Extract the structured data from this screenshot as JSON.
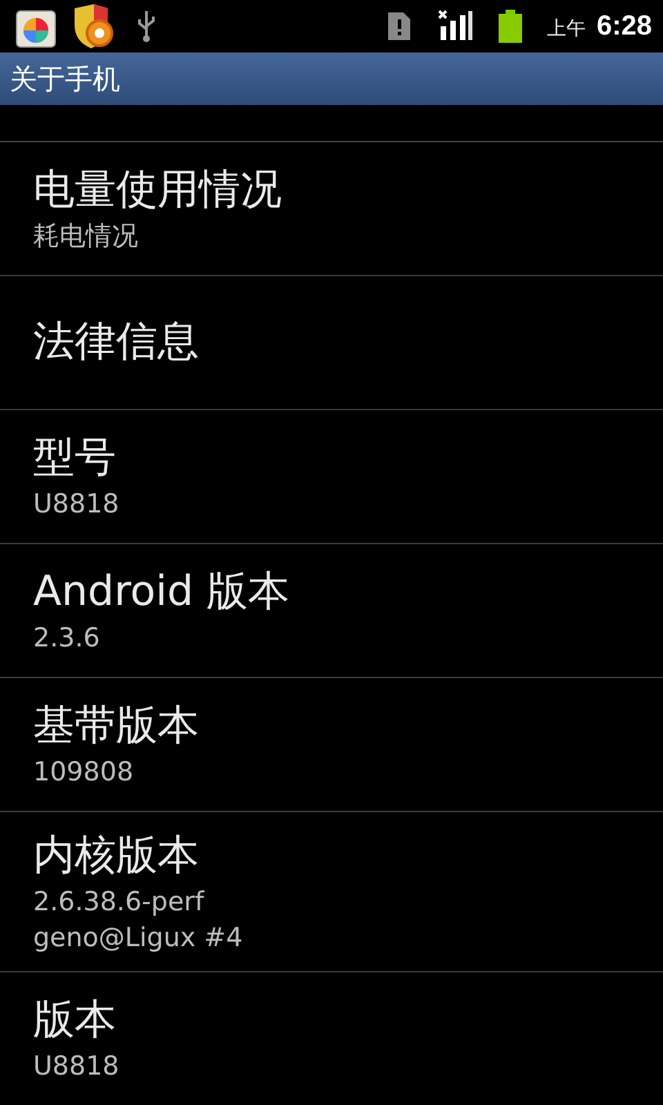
{
  "status_bar": {
    "am_pm": "上午",
    "time": "6:28"
  },
  "title_bar": {
    "title": "关于手机"
  },
  "list": {
    "items": [
      {
        "title": "电量使用情况",
        "summary": [
          "耗电情况"
        ]
      },
      {
        "title": "法律信息"
      },
      {
        "title": "型号",
        "summary": [
          "U8818"
        ]
      },
      {
        "title": "Android 版本",
        "summary": [
          "2.3.6"
        ]
      },
      {
        "title": "基带版本",
        "summary": [
          "109808"
        ]
      },
      {
        "title": "内核版本",
        "summary": [
          "2.6.38.6-perf",
          "geno@Ligux #4"
        ]
      },
      {
        "title": "版本",
        "summary": [
          "U8818"
        ]
      }
    ]
  }
}
